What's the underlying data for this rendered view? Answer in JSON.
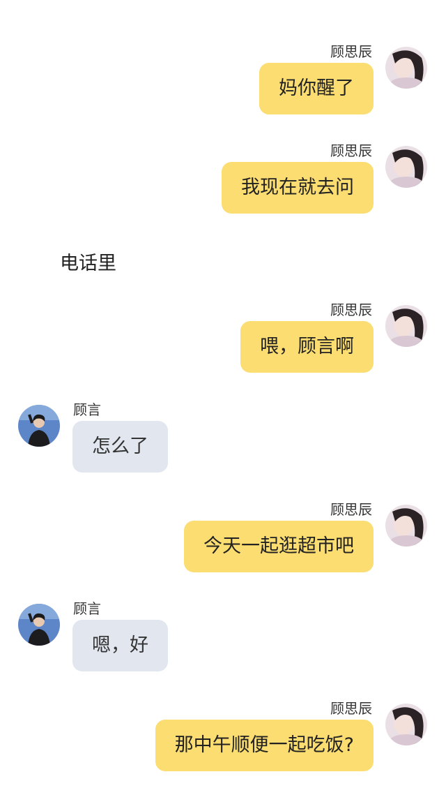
{
  "participants": {
    "mom": {
      "name": "顾思辰"
    },
    "son": {
      "name": "顾言"
    }
  },
  "messages": [
    {
      "type": "bubble",
      "side": "right",
      "sender": "顾思辰",
      "text": "妈你醒了"
    },
    {
      "type": "bubble",
      "side": "right",
      "sender": "顾思辰",
      "text": "我现在就去问"
    },
    {
      "type": "narration",
      "text": "电话里"
    },
    {
      "type": "bubble",
      "side": "right",
      "sender": "顾思辰",
      "text": "喂，顾言啊"
    },
    {
      "type": "bubble",
      "side": "left",
      "sender": "顾言",
      "text": "怎么了"
    },
    {
      "type": "bubble",
      "side": "right",
      "sender": "顾思辰",
      "text": "今天一起逛超市吧"
    },
    {
      "type": "bubble",
      "side": "left",
      "sender": "顾言",
      "text": "嗯，好"
    },
    {
      "type": "bubble",
      "side": "right",
      "sender": "顾思辰",
      "text": "那中午顺便一起吃饭?"
    }
  ],
  "colors": {
    "right_bubble": "#fcdd72",
    "left_bubble": "#e1e6ef",
    "background": "#ffffff"
  }
}
